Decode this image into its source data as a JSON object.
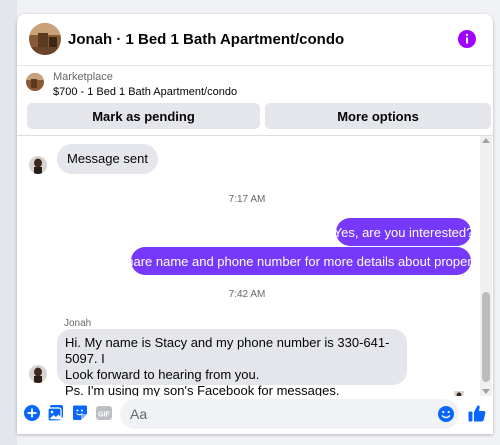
{
  "header": {
    "title": "Jonah · 1 Bed 1 Bath Apartment/condo",
    "info_icon": "info-icon",
    "accent_color": "#7638fa"
  },
  "marketplace": {
    "label": "Marketplace",
    "item": "$700 - 1 Bed 1 Bath Apartment/condo",
    "mark_pending_label": "Mark as pending",
    "more_options_label": "More options"
  },
  "messages": {
    "previous_incoming": "Message sent",
    "timestamp_1": "7:17 AM",
    "outgoing_1": "Yes, are you interested?",
    "outgoing_2": "Share name and phone number for more details about property.",
    "timestamp_2": "7:42 AM",
    "sender_name": "Jonah",
    "incoming_line_1": "Hi. My name is Stacy and my phone number is 330-641-5097. I",
    "incoming_line_2": "Look forward to hearing from you.",
    "incoming_line_3": "Ps. I'm using my son's Facebook for messages."
  },
  "composer": {
    "placeholder": "Aa",
    "icons": [
      "plus-circle-icon",
      "photo-icon",
      "sticker-icon",
      "gif-icon",
      "emoji-icon",
      "like-thumb-icon"
    ]
  },
  "colors": {
    "outgoing_bubble": "#7638fa",
    "incoming_bubble": "#e4e6eb",
    "composer_icons": "#0866ff"
  }
}
